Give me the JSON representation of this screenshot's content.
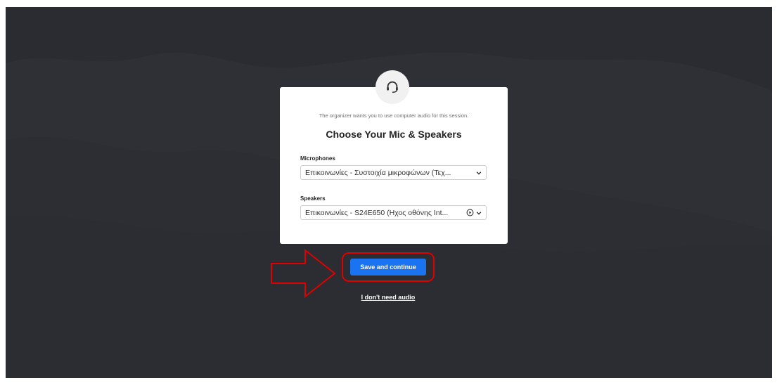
{
  "dialog": {
    "subtitle": "The organizer wants you to use computer audio for this session.",
    "title": "Choose Your Mic & Speakers",
    "icon": "headset-icon"
  },
  "microphones": {
    "label": "Microphones",
    "selected": "Επικοινωνίες - Συστοιχία μικροφώνων (Τεχ..."
  },
  "speakers": {
    "label": "Speakers",
    "selected": "Επικοινωνίες - S24E650 (Ηχος οθόνης Int..."
  },
  "actions": {
    "save_label": "Save and continue",
    "no_audio_label": "I don't need audio"
  },
  "colors": {
    "background": "#2a2c32",
    "primary": "#1a73f0",
    "annotation": "#e00000"
  }
}
